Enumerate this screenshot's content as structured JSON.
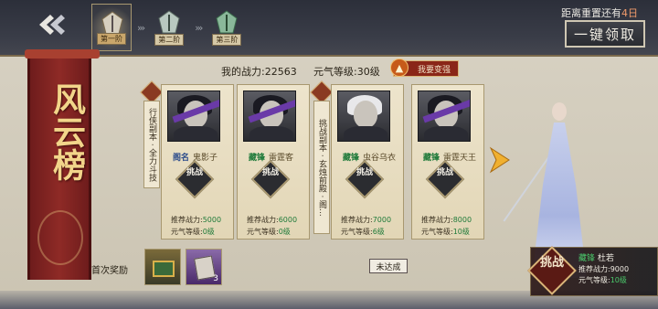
{
  "header": {
    "stages": [
      {
        "label": "第一阶",
        "active": true
      },
      {
        "label": "第二阶",
        "active": false
      },
      {
        "label": "第三阶",
        "active": false
      }
    ],
    "reset_prefix": "距离重置还有",
    "reset_days": "4日",
    "claim_all_label": "一键领取"
  },
  "banner": {
    "title": "风云榜"
  },
  "info": {
    "power_label": "我的战力:22563",
    "level_label": "元气等级:30级",
    "strengthen_label": "我要变强",
    "strengthen_icon": "up-arrow-icon"
  },
  "categories": [
    {
      "text": "行侠副本 · 全力斗技"
    },
    {
      "text": "挑战副本 · 玄烛前殿 · 阁..."
    }
  ],
  "cards": [
    {
      "tag": "阁名",
      "name": "鬼影子",
      "challenge": "挑战",
      "power_label": "推荐战力:",
      "power": "5000",
      "level_label": "元气等级:",
      "level": "0级"
    },
    {
      "tag": "藏锋",
      "name": "雷霆客",
      "challenge": "挑战",
      "power_label": "推荐战力:",
      "power": "6000",
      "level_label": "元气等级:",
      "level": "0级"
    },
    {
      "tag": "藏锋",
      "name": "虫谷乌衣",
      "challenge": "挑战",
      "power_label": "推荐战力:",
      "power": "7000",
      "level_label": "元气等级:",
      "level": "6级"
    },
    {
      "tag": "藏锋",
      "name": "雷霆天王",
      "challenge": "挑战",
      "power_label": "推荐战力:",
      "power": "8000",
      "level_label": "元气等级:",
      "level": "10级"
    }
  ],
  "rewards": {
    "label": "首次奖励",
    "items": [
      {
        "icon": "treasure-chest-icon",
        "qty": ""
      },
      {
        "icon": "book-icon",
        "qty": "3"
      }
    ],
    "status_label": "未达成"
  },
  "hero": {
    "challenge": "挑战",
    "tag": "藏锋",
    "name": "杜若",
    "power_label": "推荐战力:",
    "power": "9000",
    "level_label": "元气等级:",
    "level": "10级"
  },
  "colors": {
    "accent_red": "#8a2618",
    "gold": "#d8b478",
    "stat_green": "#1f7a3a"
  }
}
